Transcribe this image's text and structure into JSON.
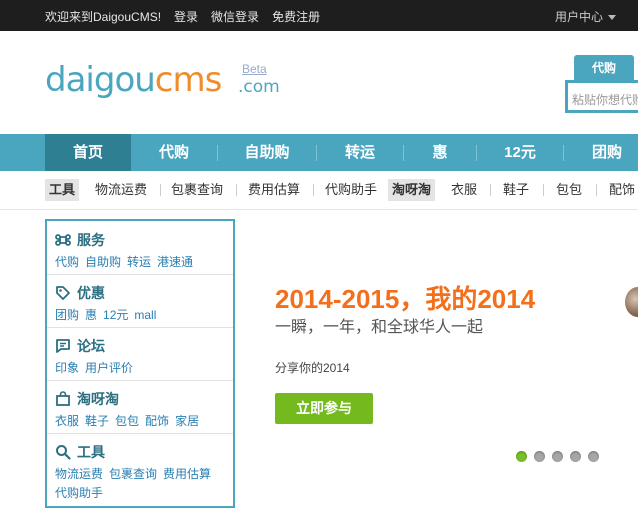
{
  "topbar": {
    "welcome": "欢迎来到DaigouCMS!",
    "login": "登录",
    "wechat_login": "微信登录",
    "register": "免费注册",
    "user_center": "用户中心"
  },
  "logo": {
    "part1": "daigou",
    "part2": "cms",
    "suffix": ".com",
    "beta": "Beta"
  },
  "daigou_box": {
    "tab": "代购",
    "placeholder": "粘贴你想代购"
  },
  "nav": {
    "items": [
      {
        "label": "首页"
      },
      {
        "label": "代购"
      },
      {
        "label": "自助购"
      },
      {
        "label": "转运"
      },
      {
        "label": "惠"
      },
      {
        "label": "12元"
      },
      {
        "label": "团购"
      }
    ]
  },
  "subnav": {
    "items": [
      {
        "label": "工具"
      },
      {
        "label": "物流运费"
      },
      {
        "label": "包裹查询"
      },
      {
        "label": "费用估算"
      },
      {
        "label": "代购助手"
      },
      {
        "label": "淘呀淘"
      },
      {
        "label": "衣服"
      },
      {
        "label": "鞋子"
      },
      {
        "label": "包包"
      },
      {
        "label": "配饰"
      }
    ]
  },
  "categories": [
    {
      "title": "服务",
      "icon": "command-icon",
      "links": [
        "代购",
        "自助购",
        "转运",
        "港速通"
      ]
    },
    {
      "title": "优惠",
      "icon": "tag-icon",
      "links": [
        "团购",
        "惠",
        "12元",
        "mall"
      ]
    },
    {
      "title": "论坛",
      "icon": "chat-icon",
      "links": [
        "印象",
        "用户评价"
      ]
    },
    {
      "title": "淘呀淘",
      "icon": "bag-icon",
      "links": [
        "衣服",
        "鞋子",
        "包包",
        "配饰",
        "家居"
      ]
    },
    {
      "title": "工具",
      "icon": "search-icon",
      "links": [
        "物流运费",
        "包裹查询",
        "费用估算",
        "代购助手"
      ]
    }
  ],
  "banner": {
    "title": "2014-2015，我的2014",
    "subtitle": "一瞬，一年，和全球华人一起",
    "share": "分享你的2014",
    "button": "立即参与",
    "slide_count": 5,
    "active_slide": 1
  },
  "colors": {
    "brand": "#4aa6bf",
    "brand_dark": "#2f7f93",
    "orange": "#f36f1b",
    "green": "#74ba1e",
    "link": "#2a7fb2"
  }
}
